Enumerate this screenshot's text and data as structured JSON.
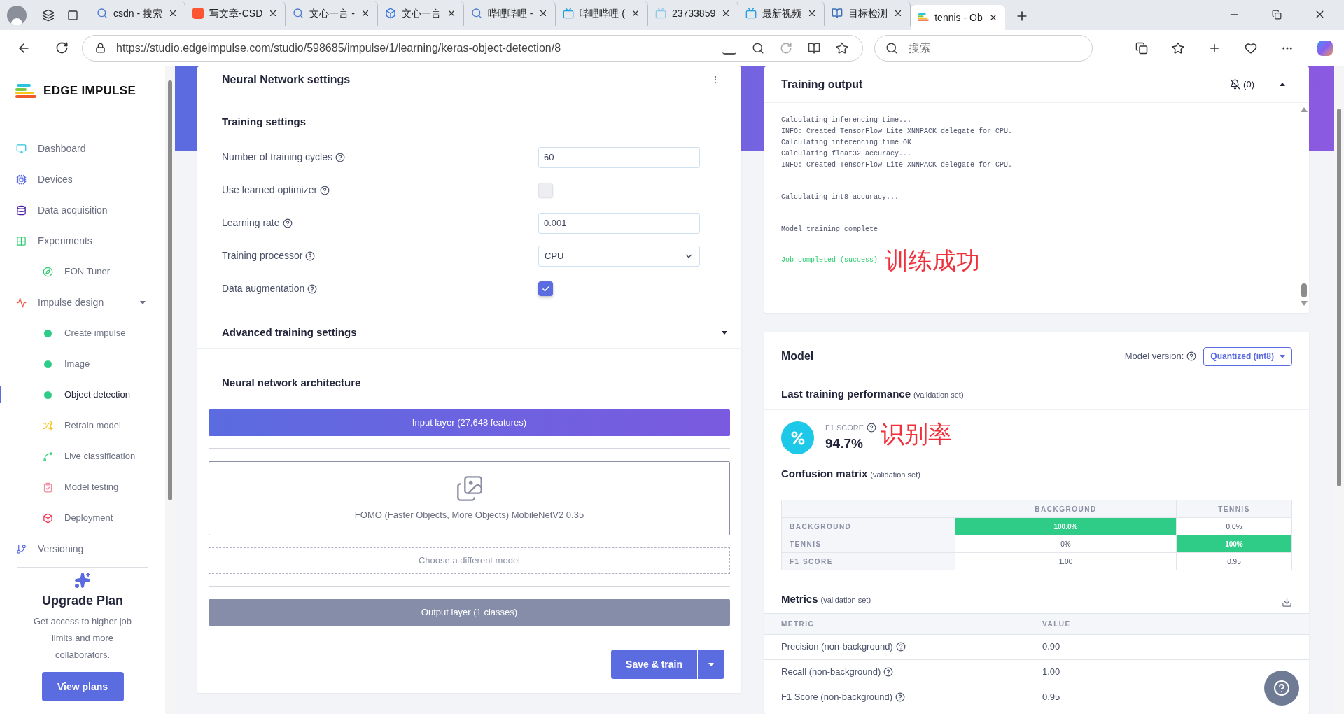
{
  "browser": {
    "tabs": [
      {
        "title": "csdn - 搜索",
        "selected": false
      },
      {
        "title": "写文章-CSD",
        "selected": false
      },
      {
        "title": "文心一言 -",
        "selected": false
      },
      {
        "title": "文心一言",
        "selected": false
      },
      {
        "title": "哔哩哔哩 -",
        "selected": false
      },
      {
        "title": "哔哩哔哩 (",
        "selected": false
      },
      {
        "title": "23733859",
        "selected": false
      },
      {
        "title": "最新视频",
        "selected": false
      },
      {
        "title": "目标检测",
        "selected": false
      },
      {
        "title": "tennis - Ob",
        "selected": true
      }
    ],
    "url": "https://studio.edgeimpulse.com/studio/598685/impulse/1/learning/keras-object-detection/8",
    "search": {
      "placeholder": "搜索"
    }
  },
  "sidebar": {
    "logo": "EDGE IMPULSE",
    "items": [
      {
        "label": "Dashboard",
        "selected": false
      },
      {
        "label": "Devices",
        "selected": false
      },
      {
        "label": "Data acquisition",
        "selected": false
      },
      {
        "label": "Experiments",
        "selected": false,
        "children": [
          {
            "label": "EON Tuner",
            "selected": false
          }
        ]
      },
      {
        "label": "Impulse design",
        "selected": false,
        "expanded": true,
        "children": [
          {
            "label": "Create impulse",
            "selected": false
          },
          {
            "label": "Image",
            "selected": false
          },
          {
            "label": "Object detection",
            "selected": true
          },
          {
            "label": "Retrain model",
            "selected": false
          },
          {
            "label": "Live classification",
            "selected": false
          },
          {
            "label": "Model testing",
            "selected": false
          },
          {
            "label": "Deployment",
            "selected": false
          }
        ]
      },
      {
        "label": "Versioning",
        "selected": false
      }
    ],
    "upgrade": {
      "title": "Upgrade Plan",
      "text": "Get access to higher job limits and more collaborators.",
      "button": "View plans"
    }
  },
  "nn_settings": {
    "title": "Neural Network settings",
    "training": {
      "title": "Training settings",
      "fields": [
        {
          "label": "Number of training cycles",
          "kind": "text",
          "value": "60"
        },
        {
          "label": "Use learned optimizer",
          "kind": "checkbox",
          "checked": false
        },
        {
          "label": "Learning rate",
          "kind": "text",
          "value": "0.001"
        },
        {
          "label": "Training processor",
          "kind": "select",
          "value": "CPU"
        },
        {
          "label": "Data augmentation",
          "kind": "checkbox",
          "checked": true
        }
      ]
    },
    "advanced": {
      "title": "Advanced training settings",
      "expanded": false
    },
    "architecture": {
      "title": "Neural network architecture",
      "input_layer": "Input layer (27,648 features)",
      "model": "FOMO (Faster Objects, More Objects) MobileNetV2 0.35",
      "choose_button": "Choose a different model",
      "output_layer": "Output layer (1 classes)"
    },
    "save_button": "Save & train"
  },
  "training_output": {
    "title": "Training output",
    "notifications": "(0)",
    "expanded": true,
    "annotation": "训练成功",
    "blocks": [
      {
        "lines": [
          {
            "text": "Calculating inferencing time...",
            "kind": "plain"
          },
          {
            "text": "INFO: Created TensorFlow Lite XNNPACK delegate for CPU.",
            "kind": "plain"
          },
          {
            "text": "Calculating inferencing time OK",
            "kind": "plain"
          },
          {
            "text": "Calculating float32 accuracy...",
            "kind": "plain"
          },
          {
            "text": "INFO: Created TensorFlow Lite XNNPACK delegate for CPU.",
            "kind": "plain"
          }
        ]
      },
      {
        "lines": [
          {
            "text": "Calculating int8 accuracy...",
            "kind": "plain"
          }
        ]
      },
      {
        "lines": [
          {
            "text": "Model training complete",
            "kind": "plain"
          }
        ]
      },
      {
        "lines": [
          {
            "text": "Job completed (success)",
            "kind": "success"
          }
        ]
      }
    ]
  },
  "model": {
    "title": "Model",
    "version_label": "Model version:",
    "version": "Quantized (int8)",
    "performance": {
      "title": "Last training performance",
      "note": "(validation set)",
      "metric_label": "F1 SCORE",
      "metric_value": "94.7%",
      "annotation": "识别率"
    },
    "confusion": {
      "title": "Confusion matrix",
      "note": "(validation set)",
      "columns": [
        "BACKGROUND",
        "TENNIS"
      ],
      "rows": [
        {
          "label": "BACKGROUND",
          "cells": [
            {
              "value": "100.0%",
              "highlighted": true
            },
            {
              "value": "0.0%",
              "highlighted": false
            }
          ]
        },
        {
          "label": "TENNIS",
          "cells": [
            {
              "value": "0%",
              "highlighted": false
            },
            {
              "value": "100%",
              "highlighted": true
            }
          ]
        },
        {
          "label": "F1 SCORE",
          "cells": [
            {
              "value": "1.00",
              "highlighted": false
            },
            {
              "value": "0.95",
              "highlighted": false
            }
          ]
        }
      ]
    },
    "metrics": {
      "title": "Metrics",
      "note": "(validation set)",
      "columns": [
        "METRIC",
        "VALUE"
      ],
      "rows": [
        {
          "metric": "Precision (non-background)",
          "value": "0.90"
        },
        {
          "metric": "Recall (non-background)",
          "value": "1.00"
        },
        {
          "metric": "F1 Score (non-background)",
          "value": "0.95"
        }
      ]
    }
  }
}
